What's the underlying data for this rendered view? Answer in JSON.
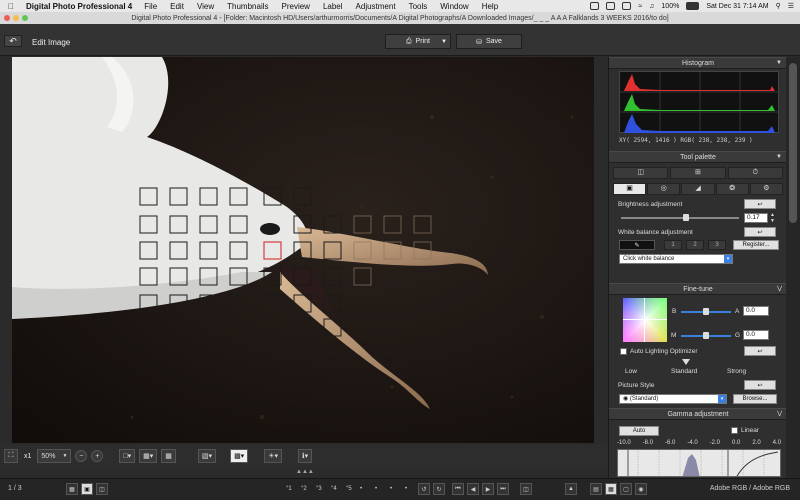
{
  "menubar": {
    "app_name": "Digital Photo Professional 4",
    "items": [
      "File",
      "Edit",
      "View",
      "Thumbnails",
      "Preview",
      "Label",
      "Adjustment",
      "Tools",
      "Window",
      "Help"
    ],
    "battery": "100%",
    "clock": "Sat Dec 31  7:14 AM"
  },
  "window": {
    "title": "Digital Photo Professional 4 - [Folder: Macintosh HD/Users/arthurmorris/Documents/A Digital Photographs/A Downloaded Images/_ _ _ A A A Falklands 3 WEEKS 2016/to do]"
  },
  "toolbar": {
    "back_label": "↶",
    "edit_title": "Edit Image",
    "print_label": "Print",
    "save_label": "Save"
  },
  "viewer": {
    "zoom_x1": "x1",
    "zoom_value": "50%",
    "image_count": "1 / 3",
    "star_labels": [
      "“1",
      "“2",
      "“3",
      "“4",
      "“5"
    ],
    "color_space": "Adobe RGB / Adobe RGB"
  },
  "histogram": {
    "header": "Histogram",
    "readout": "XY( 2594,  1416 ) RGB( 238, 238, 239 )"
  },
  "tool_palette": {
    "header": "Tool palette",
    "brightness_label": "Brightness adjustment",
    "brightness_value": "0.17",
    "brightness_level": 0.55,
    "wb_label": "White balance adjustment",
    "wb_slots": [
      "1",
      "2",
      "3"
    ],
    "register_label": "Register...",
    "wb_select": "Click white balance",
    "finetune_header": "Fine-tune",
    "b_label": "B",
    "a_label": "A",
    "m_label": "M",
    "g_label": "G",
    "a_value": "0.0",
    "g_value": "0.0",
    "alo_label": "Auto Lighting Optimizer",
    "alo_low": "Low",
    "alo_standard": "Standard",
    "alo_strong": "Strong",
    "picture_style_label": "Picture Style",
    "picture_style_value": "(Standard)",
    "browse_label": "Browse...",
    "gamma_header": "Gamma adjustment",
    "auto_label": "Auto",
    "linear_label": "Linear",
    "gamma_ticks": [
      "-10.0",
      "-8.0",
      "-6.0",
      "-4.0",
      "-2.0",
      "0.0",
      "2.0",
      "4.0"
    ]
  },
  "colors": {
    "accent": "#3b7fe0",
    "af_active": "#d04040"
  }
}
